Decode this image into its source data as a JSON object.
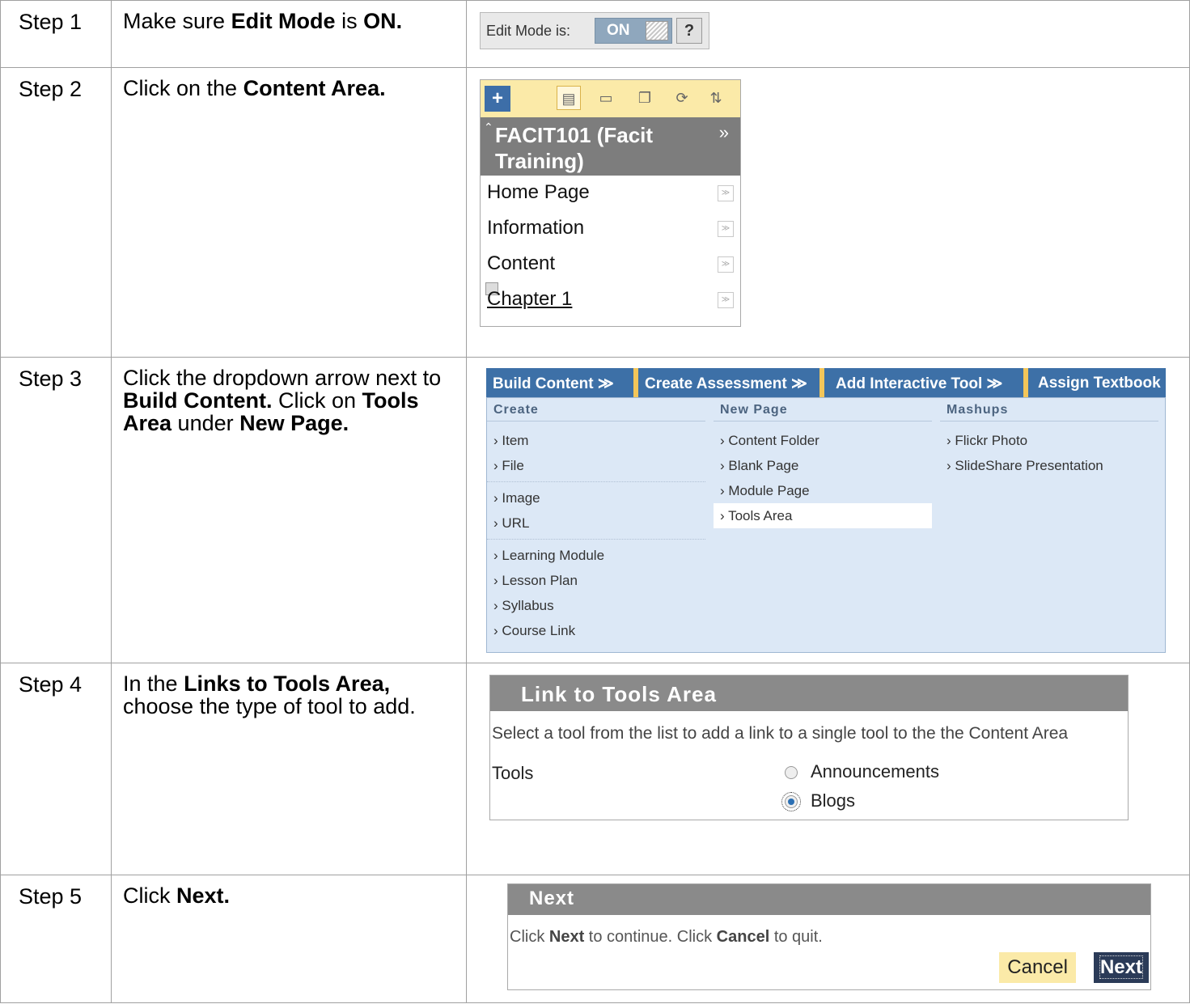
{
  "steps": [
    {
      "num": "Step 1",
      "text": [
        [
          "Make sure ",
          false
        ],
        [
          "Edit Mode",
          true
        ],
        [
          " is ",
          false
        ],
        [
          "ON.",
          true
        ]
      ]
    },
    {
      "num": "Step 2",
      "text": [
        [
          "Click on the ",
          false
        ],
        [
          "Content Area.",
          true
        ]
      ]
    },
    {
      "num": "Step 3",
      "text": [
        [
          "Click the dropdown arrow next to ",
          false
        ],
        [
          "Build Content.",
          true
        ],
        [
          "  Click on ",
          false
        ],
        [
          "Tools Area",
          true
        ],
        [
          " under ",
          false
        ],
        [
          "New Page.",
          true
        ]
      ]
    },
    {
      "num": "Step 4",
      "text": [
        [
          "In the ",
          false
        ],
        [
          "Links to Tools Area,",
          true
        ],
        [
          " choose the type of tool to add.",
          false
        ]
      ]
    },
    {
      "num": "Step 5",
      "text": [
        [
          "Click ",
          false
        ],
        [
          "Next.",
          true
        ]
      ]
    }
  ],
  "edit_mode": {
    "label": "Edit Mode is:",
    "state": "ON",
    "help": "?"
  },
  "course_menu": {
    "title": "FACIT101 (Facit Training)",
    "items": [
      {
        "label": "Home Page",
        "link": false
      },
      {
        "label": "Information",
        "link": false
      },
      {
        "label": "Content",
        "link": false
      },
      {
        "label": "Chapter 1",
        "link": true
      }
    ]
  },
  "build_content": {
    "menus": [
      "Build Content",
      "Create Assessment",
      "Add Interactive Tool",
      "Assign Textbook"
    ],
    "columns": [
      {
        "header": "Create",
        "groups": [
          [
            "Item",
            "File"
          ],
          [
            "Image",
            "URL"
          ],
          [
            "Learning Module",
            "Lesson Plan",
            "Syllabus",
            "Course Link"
          ]
        ]
      },
      {
        "header": "New Page",
        "groups": [
          [
            "Content Folder",
            "Blank Page",
            "Module Page",
            "Tools Area"
          ]
        ]
      },
      {
        "header": "Mashups",
        "groups": [
          [
            "Flickr Photo",
            "SlideShare Presentation"
          ]
        ]
      }
    ],
    "highlighted": "Tools Area"
  },
  "link_tools": {
    "title": "Link to Tools Area",
    "description": "Select a tool from the list to add a link to a single tool to the the Content Area",
    "field_label": "Tools",
    "options": [
      {
        "label": "Announcements",
        "checked": false
      },
      {
        "label": "Blogs",
        "checked": true
      }
    ]
  },
  "next_panel": {
    "title": "Next",
    "desc_parts": [
      "Click ",
      "Next",
      " to continue. Click ",
      "Cancel",
      " to quit."
    ],
    "cancel": "Cancel",
    "next": "Next"
  }
}
